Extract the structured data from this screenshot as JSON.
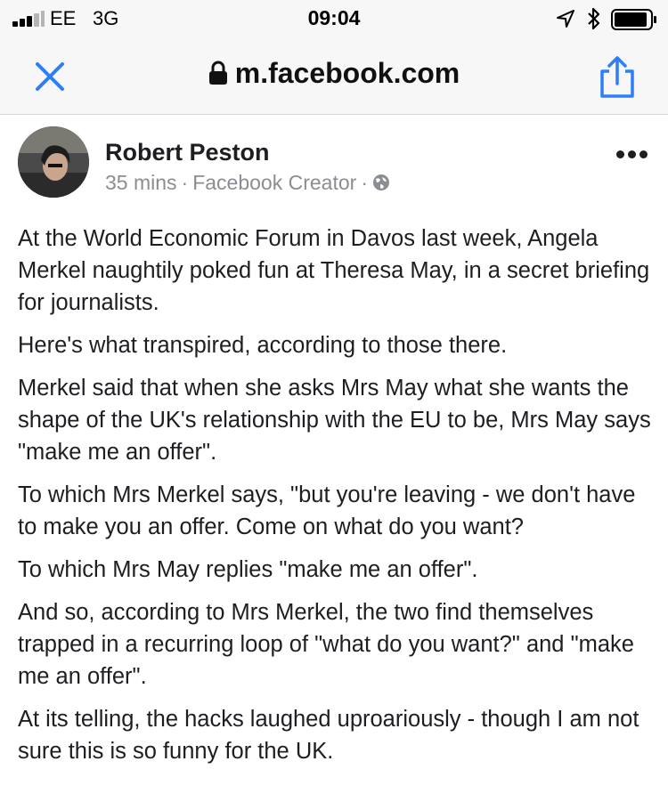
{
  "status_bar": {
    "carrier": "EE",
    "network": "3G",
    "time": "09:04",
    "signal_bars_filled": 3,
    "signal_bars_total": 5
  },
  "browser": {
    "url": "m.facebook.com",
    "close_icon": "close-icon",
    "share_icon": "share-icon",
    "accent_color": "#2d7ef7"
  },
  "post": {
    "author": "Robert Peston",
    "time_ago": "35 mins",
    "source": "Facebook Creator",
    "separator": "·",
    "privacy_icon": "globe-icon",
    "paragraphs": [
      "At the World Economic Forum in Davos last week, Angela Merkel naughtily poked fun at Theresa May, in a secret briefing for journalists.",
      "Here's what transpired, according to those there.",
      "Merkel said that when she asks Mrs May what she wants the shape of the UK's relationship with the EU to be, Mrs May says \"make me an offer\".",
      "To which Mrs Merkel says, \"but you're leaving - we don't have to make you an offer. Come on what do you want?",
      "To which Mrs May replies \"make me an offer\".",
      "And so, according to Mrs Merkel, the two find themselves trapped in a recurring loop of \"what do you want?\" and \"make me an offer\".",
      "At its telling, the hacks laughed uproariously - though I am not sure this is so funny for the UK."
    ]
  }
}
